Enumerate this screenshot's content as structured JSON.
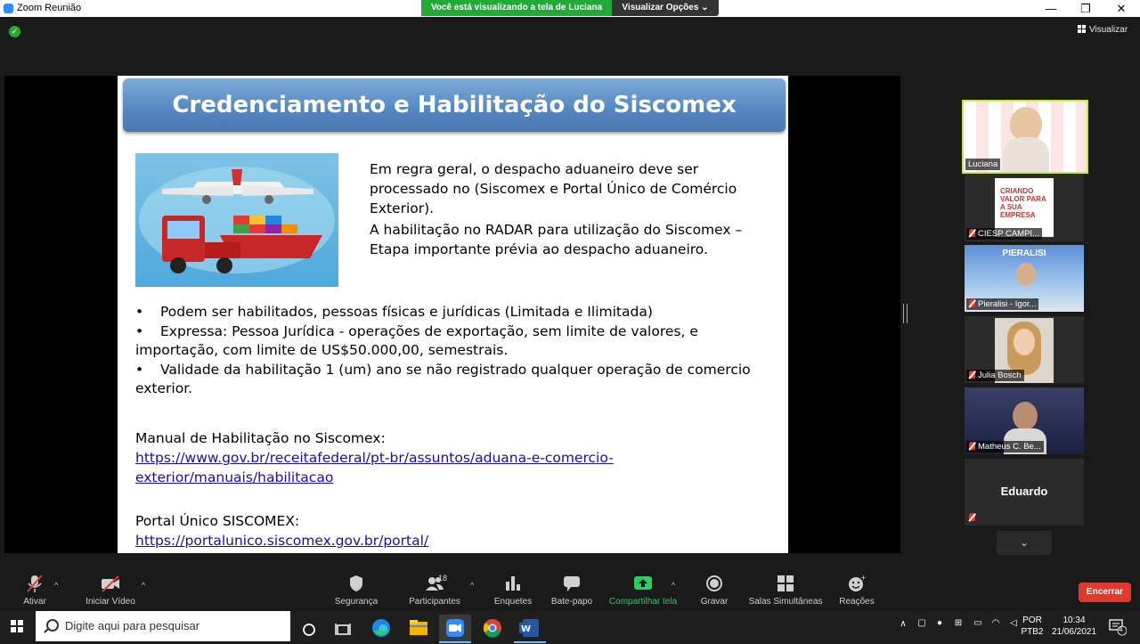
{
  "window": {
    "title": "Zoom Reunião",
    "share_banner_text": "Você está visualizando a tela de Luciana",
    "view_options_label": "Visualizar Opções",
    "minimize": "—",
    "maximize": "❐",
    "close": "✕"
  },
  "view_button": "Visualizar",
  "slide": {
    "title": "Credenciamento e Habilitação do Siscomex",
    "paragraph1": "Em regra geral, o despacho aduaneiro deve ser processado no (Siscomex e Portal Único de Comércio Exterior).",
    "paragraph2": "A habilitação no RADAR para utilização do Siscomex – Etapa importante prévia ao despacho aduaneiro.",
    "bullets": [
      "Podem ser habilitados, pessoas físicas e jurídicas (Limitada e Ilimitada)",
      "Expressa: Pessoa Jurídica - operações de exportação, sem limite de valores, e importação, com limite de US$50.000,00, semestrais.",
      "Validade da habilitação 1 (um) ano se não registrado qualquer operação de comercio exterior."
    ],
    "bullet_symbol": "•",
    "manual_label": "Manual de Habilitação no Siscomex:",
    "manual_link_line1": "https://www.gov.br/receitafederal/pt-br/assuntos/aduana-e-comercio-",
    "manual_link_line2": "exterior/manuais/habilitacao",
    "portal_label": "Portal Único SISCOMEX:",
    "portal_link": "https://portalunico.siscomex.gov.br/portal/"
  },
  "participants": [
    {
      "name": "Luciana",
      "muted": false
    },
    {
      "name": "CIESP CAMPI...",
      "muted": true,
      "poster_text": "CRIANDO VALOR PARA A SUA EMPRESA"
    },
    {
      "name": "Pieralisi - Igor...",
      "muted": true,
      "banner": "PIERALISI"
    },
    {
      "name": "Julia Bosch",
      "muted": true
    },
    {
      "name": "Matheus C. Be...",
      "muted": true
    },
    {
      "name": "Eduardo",
      "muted": true
    }
  ],
  "toolbar": {
    "unmute": "Ativar",
    "start_video": "Iniciar Vídeo",
    "security": "Segurança",
    "participants": "Participantes",
    "participants_count": "18",
    "polls": "Enquetes",
    "chat": "Bate-papo",
    "share": "Compartilhar tela",
    "record": "Gravar",
    "breakout": "Salas Simultâneas",
    "reactions": "Reações",
    "end": "Encerrar"
  },
  "taskbar": {
    "search_placeholder": "Digite aqui para pesquisar",
    "language_line1": "POR",
    "language_line2": "PTB2",
    "time": "10:34",
    "date": "21/06/2021",
    "notification_count": "4"
  },
  "colors": {
    "zoom_blue": "#2d8cff",
    "share_green": "#23a935",
    "end_red": "#e0392d",
    "active_speaker": "#c8e84a"
  }
}
